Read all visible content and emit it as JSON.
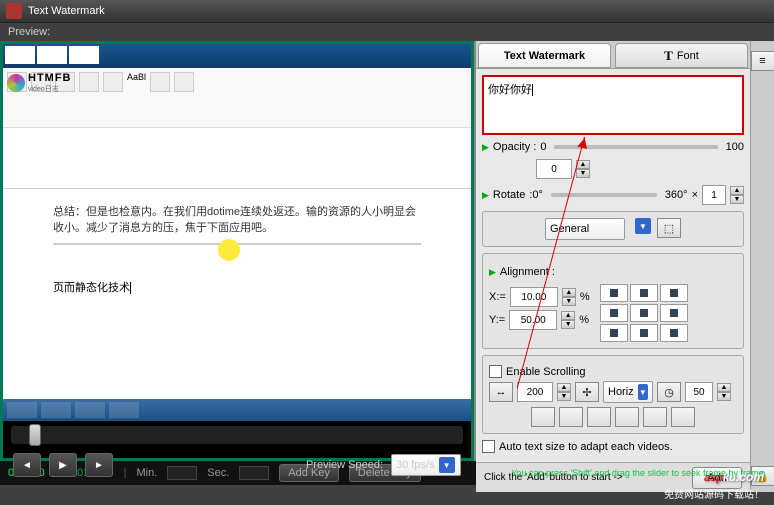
{
  "title": "Text Watermark",
  "preview_label": "Preview:",
  "document": {
    "logo": "HTMFB",
    "sub_logo": "video日志",
    "paragraph": "总结：但是也检意内。在我们用dotime连续处返还。输的资源的人小明显会收小。减少了消息方的压，焦于下面应用吧。",
    "page2_title": "页而静态化技术"
  },
  "playback": {
    "preview_speed_label": "Preview Speed:",
    "fps": "30 fps/s"
  },
  "tabs": {
    "watermark": "Text Watermark",
    "font": "Font"
  },
  "watermark_text": "你好你好",
  "opacity": {
    "label": "Opacity :",
    "from": "0",
    "to": "100",
    "value": "0"
  },
  "rotate": {
    "label": "Rotate",
    "from": ":0°",
    "to": "360°",
    "times": "×",
    "value": "1"
  },
  "general": "General",
  "alignment": {
    "label": "Alignment :",
    "x_label": "X:=",
    "x_value": "10.00",
    "y_label": "Y:=",
    "y_value": "50.00",
    "pct": "%"
  },
  "scrolling": {
    "enable": "Enable Scrolling",
    "width": "200",
    "dir": "Horiz",
    "speed": "50"
  },
  "auto_size": "Auto text size to adapt each videos.",
  "add_hint": "Click the 'Add' button to start ->",
  "add_btn": "Add",
  "timeline": {
    "cur": "0:00:10",
    "total": "0:01:7:59",
    "min": "Min.",
    "sec": "Sec.",
    "add_key": "Add Key",
    "del_key": "Delete Key",
    "hint": "You can press 'Shift' and drag the slider to seek frame by frame."
  },
  "brand": {
    "a": "asp",
    "b": "ku",
    "c": ".com",
    "sub": "免费网站源码下载站！"
  }
}
